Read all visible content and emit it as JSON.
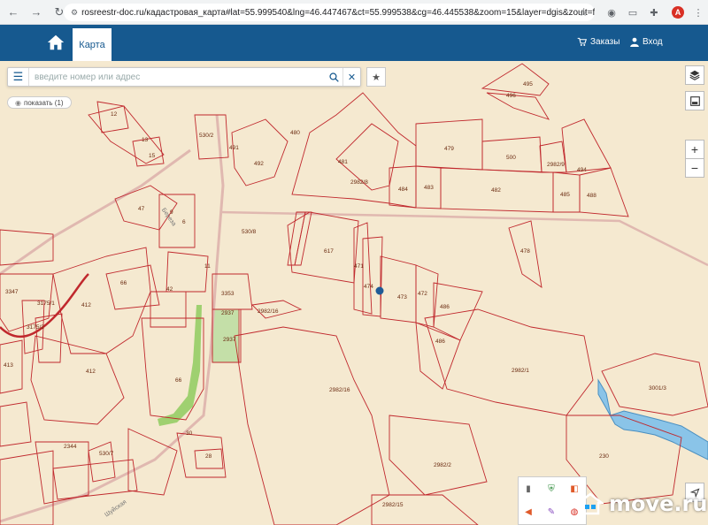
{
  "browser": {
    "url": "rosreestr-doc.ru/кадастровая_карта#lat=55.999540&lng=46.447467&ct=55.999538&cg=46.445538&zoom=15&layer=dgis&zouit=false",
    "avatar_letter": "A"
  },
  "header": {
    "tab_map": "Карта",
    "orders": "Заказы",
    "login": "Вход"
  },
  "search": {
    "placeholder": "введите номер или адрес",
    "show_button": "показать (1)"
  },
  "map": {
    "zoom_in": "+",
    "zoom_out": "−",
    "parcels": [
      {
        "label": "495"
      },
      {
        "label": "496"
      },
      {
        "label": "480"
      },
      {
        "label": "481"
      },
      {
        "label": "479"
      },
      {
        "label": "500"
      },
      {
        "label": "2982/9"
      },
      {
        "label": "494"
      },
      {
        "label": "2982/8"
      },
      {
        "label": "484"
      },
      {
        "label": "483"
      },
      {
        "label": "482"
      },
      {
        "label": "485"
      },
      {
        "label": "488"
      },
      {
        "label": "491"
      },
      {
        "label": "492"
      },
      {
        "label": "530/2"
      },
      {
        "label": "530/8"
      },
      {
        "label": "478"
      },
      {
        "label": "617"
      },
      {
        "label": "471"
      },
      {
        "label": "474"
      },
      {
        "label": "473"
      },
      {
        "label": "472"
      },
      {
        "label": "486"
      },
      {
        "label": "486"
      },
      {
        "label": "3353"
      },
      {
        "label": "2937"
      },
      {
        "label": "2937"
      },
      {
        "label": "2982/16"
      },
      {
        "label": "2982/16"
      },
      {
        "label": "2982/1"
      },
      {
        "label": "3001/3"
      },
      {
        "label": "230"
      },
      {
        "label": "2982/2"
      },
      {
        "label": "2982/15"
      },
      {
        "label": "412"
      },
      {
        "label": "412"
      },
      {
        "label": "3347"
      },
      {
        "label": "3175/1"
      },
      {
        "label": "3175/2"
      },
      {
        "label": "413"
      },
      {
        "label": "66"
      },
      {
        "label": "66"
      },
      {
        "label": "2344"
      },
      {
        "label": "530/7"
      },
      {
        "label": "28"
      },
      {
        "label": "30"
      },
      {
        "label": "42"
      },
      {
        "label": "12"
      },
      {
        "label": "11"
      },
      {
        "label": "6"
      },
      {
        "label": "9"
      },
      {
        "label": "13"
      },
      {
        "label": "15"
      },
      {
        "label": "47"
      }
    ],
    "street_labels": [
      {
        "label": "Береза"
      },
      {
        "label": "Шуйская"
      }
    ]
  },
  "watermark": "move.ru",
  "colors": {
    "header": "#16598f",
    "parcel_line": "#c0282d",
    "map_bg": "#f5e9d0",
    "water": "#4aa3d8",
    "marker": "#1f5b96"
  },
  "icons": {
    "home": "home-icon",
    "cart": "cart-icon",
    "user": "user-icon",
    "menu": "menu-icon",
    "search": "search-icon",
    "close": "close-icon",
    "star": "star-icon",
    "eye": "eye-icon",
    "layers": "layers-icon",
    "fullscreen": "fullscreen-icon",
    "locate": "locate-icon"
  }
}
